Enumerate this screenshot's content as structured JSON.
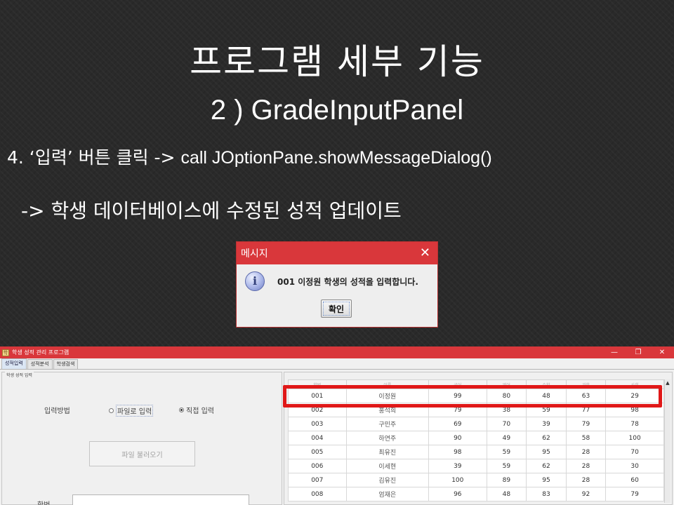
{
  "slide": {
    "title": "프로그램 세부 기능",
    "subtitle": "2 ) GradeInputPanel",
    "step_prefix": "4. ‘입력’ 버튼 클릭 -> ",
    "step_code": "call JOptionPane.showMessageDialog()",
    "result": "-> 학생 데이터베이스에 수정된 성적 업데이트"
  },
  "dialog": {
    "title": "메시지",
    "close_glyph": "✕",
    "icon_glyph": "i",
    "message": "001 이정원 학생의 성적을 입력합니다.",
    "ok_label": "확인"
  },
  "app": {
    "title": "학생 성적 관리 프로그램",
    "icon_glyph": "학",
    "controls": {
      "minimize": "—",
      "maximize": "❐",
      "close": "✕"
    },
    "tabs": [
      "성적입력",
      "성적분석",
      "학생검색"
    ],
    "panel_legend": "학생 성적 입력",
    "input_method_label": "입력방법",
    "radio_file": "파일로 입력",
    "radio_direct": "직접 입력",
    "load_button": "파일 불러오기",
    "student_no_label": "학번",
    "scroll_up": "▲"
  },
  "table": {
    "headers": [
      "학번",
      "이름",
      "국어",
      "영어",
      "수학",
      "과학",
      "사회"
    ],
    "rows": [
      [
        "001",
        "이정원",
        "99",
        "80",
        "48",
        "63",
        "29"
      ],
      [
        "002",
        "홍석희",
        "79",
        "38",
        "59",
        "77",
        "98"
      ],
      [
        "003",
        "구민주",
        "69",
        "70",
        "39",
        "79",
        "78"
      ],
      [
        "004",
        "하연주",
        "90",
        "49",
        "62",
        "58",
        "100"
      ],
      [
        "005",
        "최유진",
        "98",
        "59",
        "95",
        "28",
        "70"
      ],
      [
        "006",
        "이세현",
        "39",
        "59",
        "62",
        "28",
        "30"
      ],
      [
        "007",
        "김유진",
        "100",
        "89",
        "95",
        "28",
        "60"
      ],
      [
        "008",
        "엄재은",
        "96",
        "48",
        "83",
        "92",
        "79"
      ]
    ]
  },
  "colors": {
    "titlebar": "#d9373b",
    "highlight": "#e01818"
  }
}
